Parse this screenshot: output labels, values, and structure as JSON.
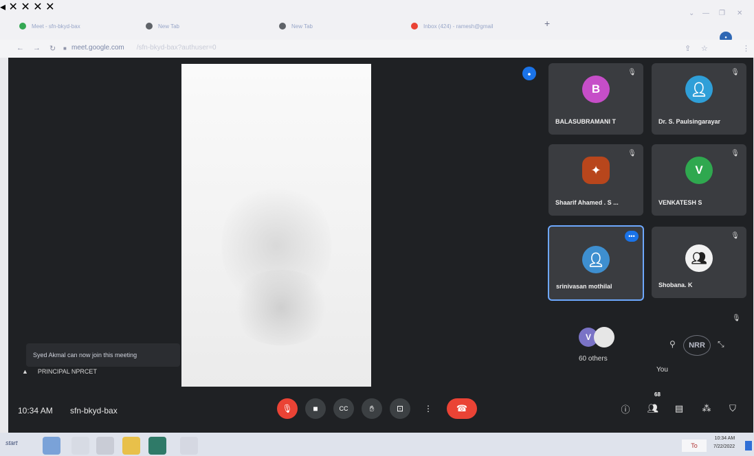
{
  "browser": {
    "tabs": [
      {
        "title": "Meet - sfn-bkyd-bax",
        "favicon_color": "#34a853"
      },
      {
        "title": "New Tab",
        "favicon_color": "#5f6368"
      },
      {
        "title": "New Tab",
        "favicon_color": "#5f6368"
      },
      {
        "title": "Inbox (424) - ramesh@gmail",
        "favicon_color": "#ea4335"
      }
    ],
    "new_tab_glyph": "+",
    "url": "meet.google.com",
    "url_path": "/sfn-bkyd-bax?authuser=0"
  },
  "meet": {
    "participants": [
      {
        "name": "BALASUBRAMANI T",
        "initial": "B",
        "avatar_color": "#c64ec8"
      },
      {
        "name": "Dr. S. Paulsingarayar",
        "initial": "",
        "avatar_color": "#2f9fd8"
      },
      {
        "name": "Shaarif Ahamed . S ...",
        "initial": "",
        "avatar_color": "#b8461c"
      },
      {
        "name": "VENKATESH S",
        "initial": "V",
        "avatar_color": "#2fa84f"
      },
      {
        "name": "srinivasan mothilal",
        "initial": "",
        "avatar_color": "#3e8fd0"
      },
      {
        "name": "Shobana. K",
        "initial": "",
        "avatar_color": "#f2f2f2"
      }
    ],
    "others": {
      "initial": "V",
      "label": "60 others"
    },
    "you_label": "You",
    "you_logo_text": "NRR",
    "notification": "Syed Akmal can now join this meeting",
    "presenter": "PRINCIPAL NPRCET",
    "time": "10:34 AM",
    "meeting_code": "sfn-bkyd-bax",
    "participant_count": "68"
  },
  "taskbar": {
    "start_label": "start",
    "clock_time": "10:34 AM",
    "clock_date": "7/22/2022",
    "tray_label": "To"
  }
}
